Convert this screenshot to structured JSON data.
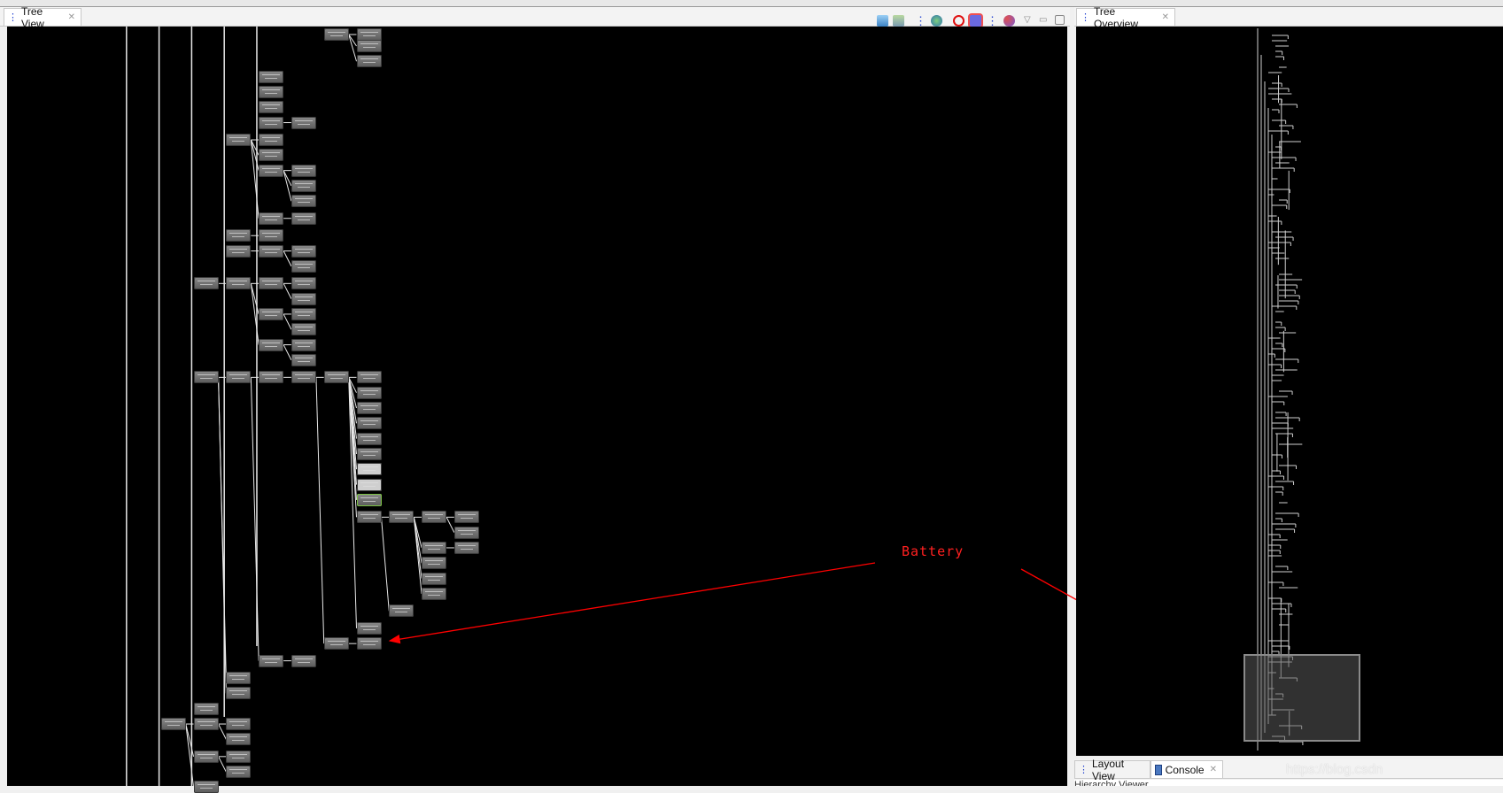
{
  "tree_view": {
    "tab_label": "Tree View",
    "close_icon": "close-icon",
    "toolbar_icons": [
      "save-as-png-icon",
      "capture-layers-icon",
      "load-view-hierarchy-icon",
      "display-view-icon",
      "invalidate-icon",
      "request-layout-icon",
      "dump-displaylist-icon",
      "profile-nodes-icon",
      "view-menu-icon",
      "minimize-icon",
      "maximize-icon"
    ]
  },
  "tree_overview": {
    "tab_label": "Tree Overview"
  },
  "bottom_panel": {
    "tabs": [
      {
        "label": "Layout View"
      },
      {
        "label": "Console"
      }
    ],
    "partial_text": "Hierarchy Viewer"
  },
  "annotation": {
    "label": "Battery",
    "color": "#ff0000"
  },
  "watermark": "https://blog.csdn"
}
